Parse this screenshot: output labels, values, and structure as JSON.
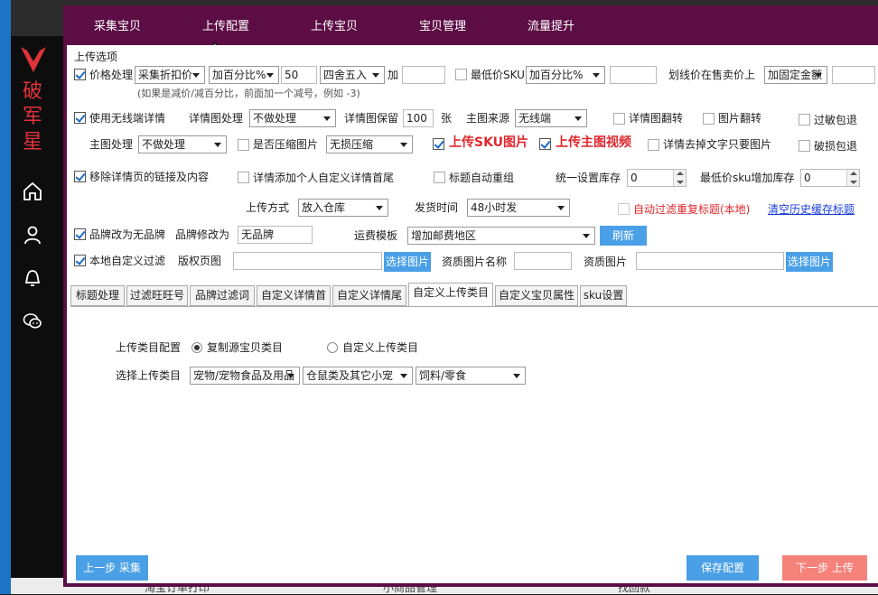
{
  "sidebar": {
    "brand": "破军星",
    "icons": [
      "home-icon",
      "user-icon",
      "bell-icon",
      "wechat-icon"
    ]
  },
  "menu": [
    "采集宝贝",
    "上传配置",
    "上传宝贝",
    "宝贝管理",
    "流量提升"
  ],
  "section_title": "上传选项",
  "row1": {
    "price_label": "价格处理",
    "price_mode": "采集折扣价",
    "calc_mode": "加百分比%",
    "calc_value": "50",
    "round_mode": "四舍五入",
    "plus_label": "加",
    "min_sku_label": "最低价SKU",
    "min_sku_mode": "加百分比%",
    "strike_label": "划线价在售卖价上",
    "strike_mode": "加固定金额",
    "hint": "(如果是减价/减百分比，前面加一个减号，例如 -3)"
  },
  "row2": {
    "wireless_label": "使用无线端详情",
    "detail_img_label": "详情图处理",
    "detail_img_mode": "不做处理",
    "detail_keep_label": "详情图保留",
    "detail_keep_value": "100",
    "detail_keep_unit": "张",
    "main_src_label": "主图来源",
    "main_src_value": "无线端",
    "detail_flip": "详情图翻转",
    "img_flip": "图片翻转",
    "filter_pkg": "过敏包退"
  },
  "row3": {
    "main_img_label": "主图处理",
    "main_img_mode": "不做处理",
    "compress_label": "是否压缩图片",
    "compress_mode": "无损压缩",
    "upload_sku": "上传SKU图片",
    "upload_video": "上传主图视频",
    "detail_text": "详情去掉文字只要图片",
    "damage_pkg": "破损包退"
  },
  "row4": {
    "remove_links": "移除详情页的链接及内容",
    "detail_header": "详情添加个人自定义详情首尾",
    "title_regroup": "标题自动重组",
    "stock_label": "统一设置库存",
    "stock_value": "0",
    "min_sku_stock_label": "最低价sku增加库存",
    "min_sku_stock_value": "0"
  },
  "row5": {
    "upload_way_label": "上传方式",
    "upload_way": "放入仓库",
    "ship_label": "发货时间",
    "ship_value": "48小时发",
    "auto_filter": "自动过滤重复标题(本地)",
    "clear_history": "清空历史缓存标题"
  },
  "row6": {
    "brand_none": "品牌改为无品牌",
    "brand_change_label": "品牌修改为",
    "brand_value": "无品牌",
    "freight_label": "运费模板",
    "freight_value": "增加邮费地区",
    "refresh": "刷新"
  },
  "row7": {
    "local_filter": "本地自定义过滤",
    "copyright_label": "版权页图",
    "choose1": "选择图片",
    "qual_name_label": "资质图片名称",
    "qual_img_label": "资质图片",
    "choose2": "选择图片"
  },
  "tabs": [
    "标题处理",
    "过滤旺旺号",
    "品牌过滤词",
    "自定义详情首",
    "自定义详情尾",
    "自定义上传类目",
    "自定义宝贝属性",
    "sku设置"
  ],
  "tab_active_index": 5,
  "category": {
    "config_label": "上传类目配置",
    "opt1": "复制源宝贝类目",
    "opt2": "自定义上传类目",
    "select_label": "选择上传类目",
    "cat1": "宠物/宠物食品及用品",
    "cat2": "仓鼠类及其它小宠",
    "cat3": "饲料/零食"
  },
  "footer": {
    "prev": "上一步 采集",
    "save": "保存配置",
    "next": "下一步 上传"
  },
  "background_bottom": [
    "淘宝订单打印",
    "小商品管理",
    "找回款"
  ],
  "colors": {
    "window_frame": "#5c0d44",
    "accent_blue": "#4aa0e6",
    "next_button": "#f5837a",
    "brand_red": "#e0333a"
  }
}
